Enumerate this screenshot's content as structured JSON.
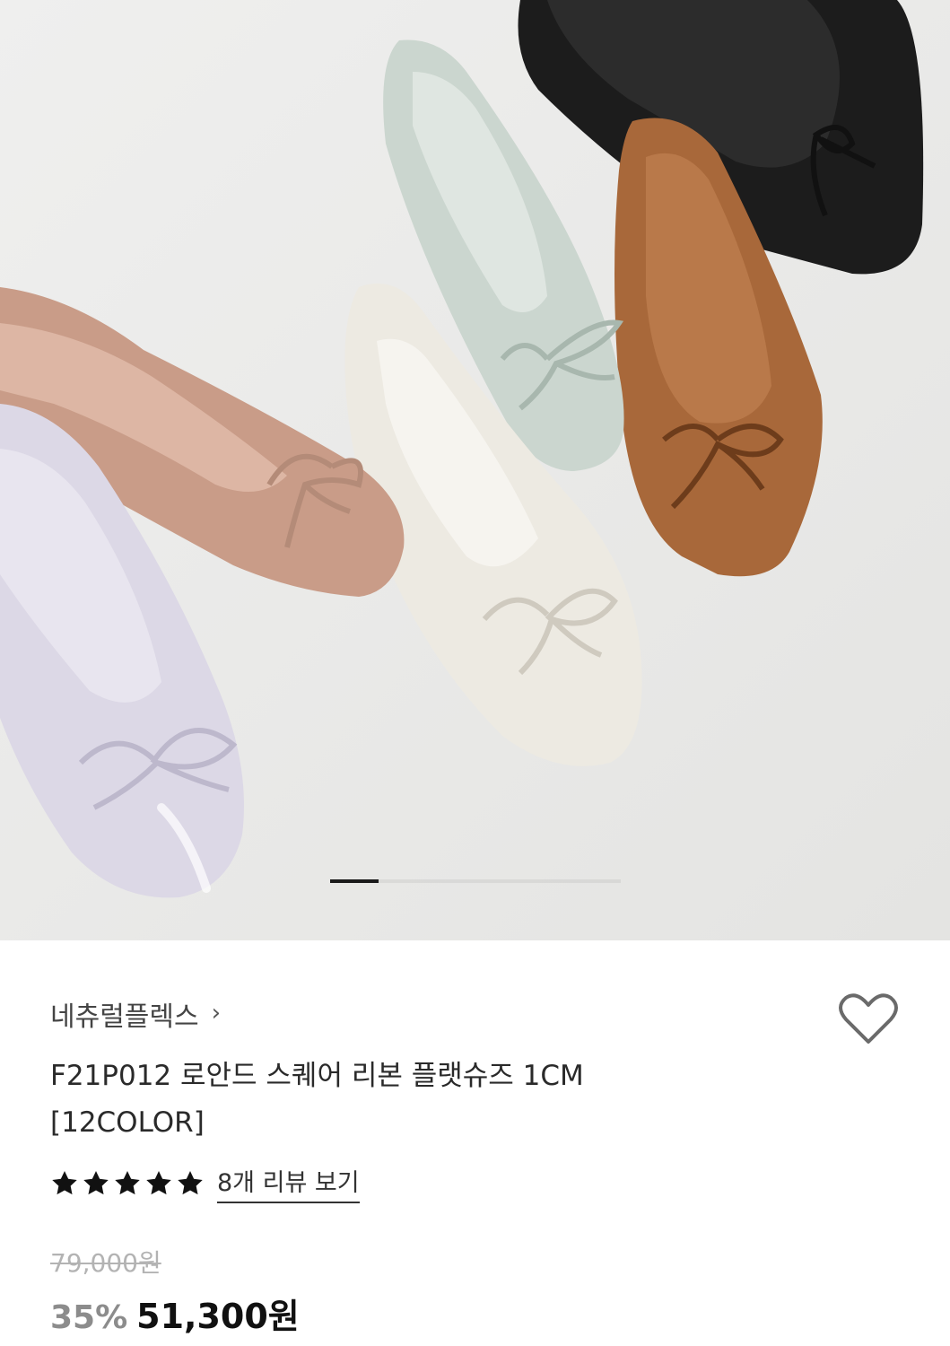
{
  "product": {
    "brand": "네츄럴플렉스",
    "title_line1": "F21P012 로안드 스퀘어 리본 플랫슈즈 1CM",
    "title_line2": "[12COLOR]",
    "rating": 5,
    "review_link": "8개 리뷰 보기",
    "original_price": "79,000원",
    "discount": "35%",
    "price": "51,300원"
  },
  "gallery": {
    "current_index": 1,
    "shoe_colors": [
      "#c99c88",
      "#dcd8e6",
      "#edeae2",
      "#cbd6cf",
      "#a8683a",
      "#1c1c1c"
    ]
  },
  "icons": {
    "brand_chevron": "chevron-right-icon",
    "favorite": "heart-outline-icon",
    "star": "star-filled-icon"
  },
  "colors": {
    "background": "#ebebea",
    "price": "#111111",
    "discount": "#8c8c8c",
    "original_price": "#b3b3b3"
  }
}
